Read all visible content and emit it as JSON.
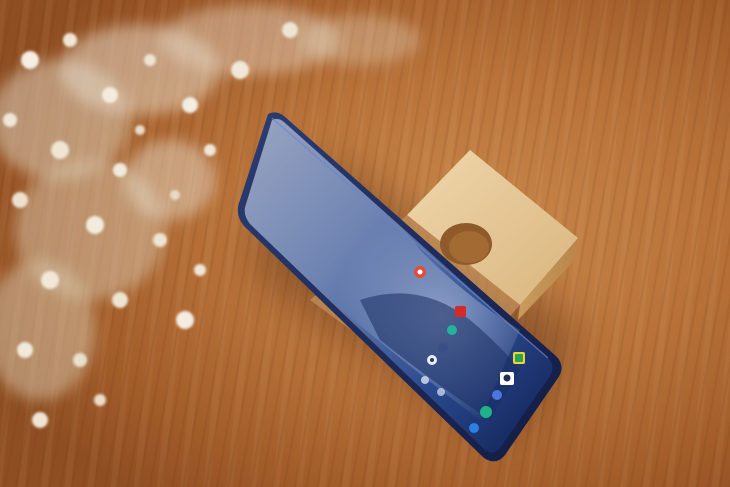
{
  "scene": {
    "subject": "",
    "colors": {
      "wood": "#b9733a",
      "stand": "#e6c897",
      "phone_frame": "#1b2a5a",
      "screen_top": "#7d8fb5",
      "screen_bottom": "#1a2f6b",
      "flowers": "#efe6d8"
    },
    "icons": [
      "app-icon-red",
      "app-icon-green",
      "app-icon-teal",
      "app-icon-yellow",
      "app-icon-blue",
      "app-icon-white"
    ]
  }
}
